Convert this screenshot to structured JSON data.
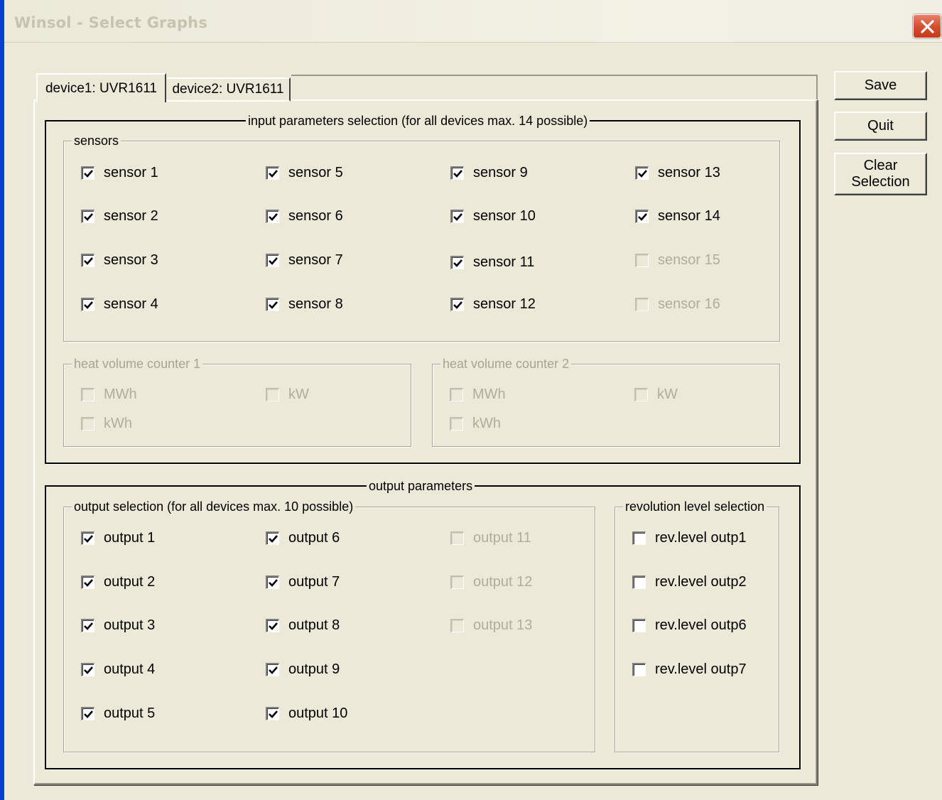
{
  "window": {
    "title": "Winsol - Select Graphs"
  },
  "buttons": {
    "save": "Save",
    "quit": "Quit",
    "clear_line1": "Clear",
    "clear_line2": "Selection"
  },
  "tabs": [
    {
      "label": "device1: UVR1611",
      "active": true
    },
    {
      "label": "device2: UVR1611",
      "active": false
    }
  ],
  "input_params": {
    "legend": "input parameters selection (for all devices max. 14 possible)",
    "sensors_legend": "sensors",
    "sensors": [
      {
        "label": "sensor 1",
        "checked": true,
        "enabled": true
      },
      {
        "label": "sensor 2",
        "checked": true,
        "enabled": true
      },
      {
        "label": "sensor 3",
        "checked": true,
        "enabled": true
      },
      {
        "label": "sensor 4",
        "checked": true,
        "enabled": true
      },
      {
        "label": "sensor 5",
        "checked": true,
        "enabled": true
      },
      {
        "label": "sensor 6",
        "checked": true,
        "enabled": true
      },
      {
        "label": "sensor 7",
        "checked": true,
        "enabled": true
      },
      {
        "label": "sensor 8",
        "checked": true,
        "enabled": true
      },
      {
        "label": "sensor 9",
        "checked": true,
        "enabled": true
      },
      {
        "label": "sensor 10",
        "checked": true,
        "enabled": true
      },
      {
        "label": "sensor 11",
        "checked": true,
        "enabled": true
      },
      {
        "label": "sensor 12",
        "checked": true,
        "enabled": true
      },
      {
        "label": "sensor 13",
        "checked": true,
        "enabled": true
      },
      {
        "label": "sensor 14",
        "checked": true,
        "enabled": true
      },
      {
        "label": "sensor 15",
        "checked": false,
        "enabled": false
      },
      {
        "label": "sensor 16",
        "checked": false,
        "enabled": false
      }
    ],
    "hvc1": {
      "legend": "heat volume counter 1",
      "items": [
        {
          "label": "MWh",
          "checked": false,
          "enabled": false
        },
        {
          "label": "kW",
          "checked": false,
          "enabled": false
        },
        {
          "label": "kWh",
          "checked": false,
          "enabled": false
        }
      ]
    },
    "hvc2": {
      "legend": "heat volume counter 2",
      "items": [
        {
          "label": "MWh",
          "checked": false,
          "enabled": false
        },
        {
          "label": "kW",
          "checked": false,
          "enabled": false
        },
        {
          "label": "kWh",
          "checked": false,
          "enabled": false
        }
      ]
    }
  },
  "output_params": {
    "legend": "output parameters",
    "selection_legend": "output selection (for all devices max. 10 possible)",
    "outputs": [
      {
        "label": "output 1",
        "checked": true,
        "enabled": true
      },
      {
        "label": "output 2",
        "checked": true,
        "enabled": true
      },
      {
        "label": "output 3",
        "checked": true,
        "enabled": true
      },
      {
        "label": "output 4",
        "checked": true,
        "enabled": true
      },
      {
        "label": "output 5",
        "checked": true,
        "enabled": true
      },
      {
        "label": "output 6",
        "checked": true,
        "enabled": true
      },
      {
        "label": "output 7",
        "checked": true,
        "enabled": true
      },
      {
        "label": "output 8",
        "checked": true,
        "enabled": true
      },
      {
        "label": "output 9",
        "checked": true,
        "enabled": true
      },
      {
        "label": "output 10",
        "checked": true,
        "enabled": true
      },
      {
        "label": "output 11",
        "checked": false,
        "enabled": false
      },
      {
        "label": "output 12",
        "checked": false,
        "enabled": false
      },
      {
        "label": "output 13",
        "checked": false,
        "enabled": false
      }
    ],
    "rev_legend": "revolution level selection",
    "rev_levels": [
      {
        "label": "rev.level outp1",
        "checked": false,
        "enabled": true
      },
      {
        "label": "rev.level outp2",
        "checked": false,
        "enabled": true
      },
      {
        "label": "rev.level outp6",
        "checked": false,
        "enabled": true
      },
      {
        "label": "rev.level outp7",
        "checked": false,
        "enabled": true
      }
    ]
  }
}
